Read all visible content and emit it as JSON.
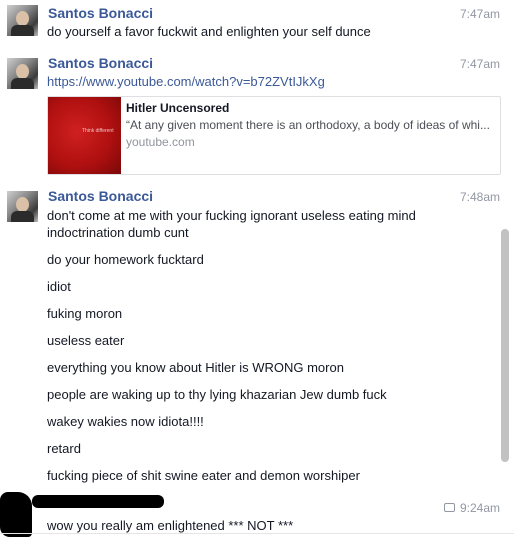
{
  "messages": [
    {
      "sender": "Santos Bonacci",
      "time": "7:47am",
      "lines": [
        "do yourself a favor fuckwit and enlighten your self dunce"
      ]
    },
    {
      "sender": "Santos Bonacci",
      "time": "7:47am",
      "link": "https://www.youtube.com/watch?v=b72ZVtIJkXg",
      "preview": {
        "title": "Hitler Uncensored",
        "description": "“At any given moment there is an orthodoxy, a body of ideas of whi...",
        "domain": "youtube.com",
        "thumb_text": "Think different"
      }
    },
    {
      "sender": "Santos Bonacci",
      "time": "7:48am",
      "lines": [
        "don't come at me with your fucking ignorant useless eating mind",
        "indoctrination dumb cunt",
        "do your homework fucktard",
        "idiot",
        "fuking moron",
        "useless eater",
        "everything you know about Hitler is WRONG moron",
        "people are waking up to thy lying khazarian Jew dumb fuck",
        "wakey wakies now idiota!!!!",
        "retard",
        "fucking piece of shit swine eater and demon worshiper"
      ]
    },
    {
      "time": "9:24am",
      "lines": [
        "wow  you really am enlightened  *** NOT ***"
      ]
    }
  ]
}
